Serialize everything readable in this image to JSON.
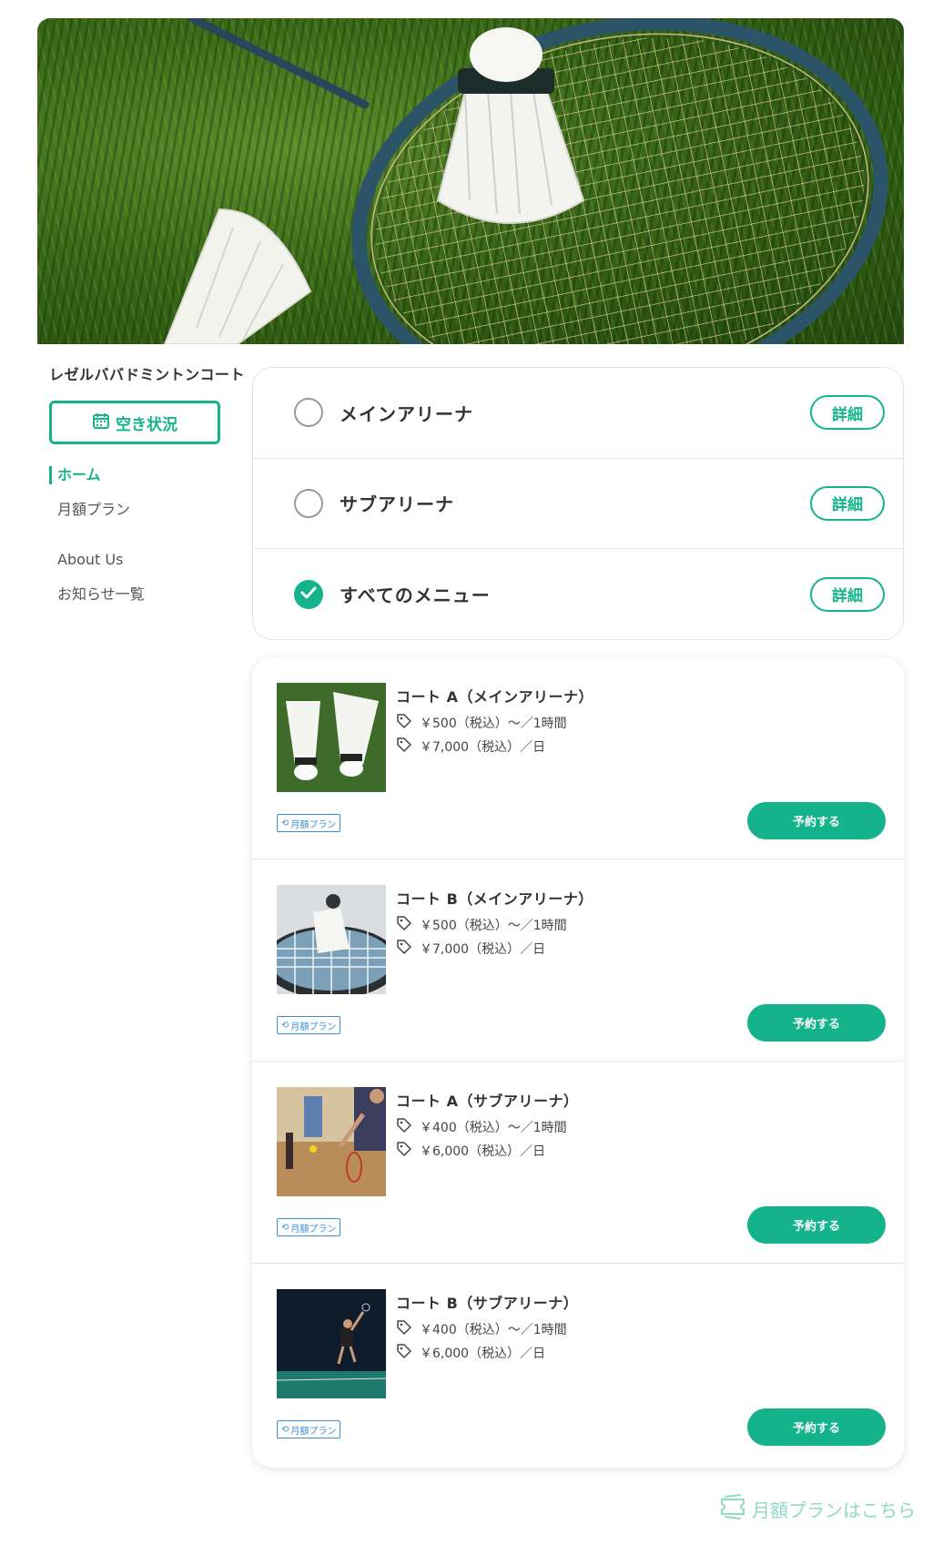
{
  "site": {
    "title": "レゼルババドミントンコート"
  },
  "sidebar": {
    "availability_label": "空き状況",
    "nav": [
      {
        "label": "ホーム",
        "active": true
      },
      {
        "label": "月額プラン",
        "active": false
      },
      {
        "label": "About Us",
        "active": false
      },
      {
        "label": "お知らせ一覧",
        "active": false
      }
    ]
  },
  "menus": [
    {
      "label": "メインアリーナ",
      "checked": false,
      "detail_label": "詳細"
    },
    {
      "label": "サブアリーナ",
      "checked": false,
      "detail_label": "詳細"
    },
    {
      "label": "すべてのメニュー",
      "checked": true,
      "detail_label": "詳細"
    }
  ],
  "courses": [
    {
      "name": "コート A（メインアリーナ）",
      "price_hour": "￥500（税込）〜／1時間",
      "price_day": "￥7,000（税込）／日",
      "badge": "月額プラン",
      "reserve_label": "予約する",
      "image": "shuttlecocks-on-grass"
    },
    {
      "name": "コート B（メインアリーナ）",
      "price_hour": "￥500（税込）〜／1時間",
      "price_day": "￥7,000（税込）／日",
      "badge": "月額プラン",
      "reserve_label": "予約する",
      "image": "shuttlecock-on-racket"
    },
    {
      "name": "コート A（サブアリーナ）",
      "price_hour": "￥400（税込）〜／1時間",
      "price_day": "￥6,000（税込）／日",
      "badge": "月額プラン",
      "reserve_label": "予約する",
      "image": "player-serving"
    },
    {
      "name": "コート B（サブアリーナ）",
      "price_hour": "￥400（税込）〜／1時間",
      "price_day": "￥6,000（税込）／日",
      "badge": "月額プラン",
      "reserve_label": "予約する",
      "image": "player-jumping"
    }
  ],
  "footer": {
    "monthly_link": "月額プランはこちら"
  },
  "colors": {
    "accent": "#14b38c",
    "badge": "#3a8fd6",
    "link_light": "#8fd9c6"
  }
}
